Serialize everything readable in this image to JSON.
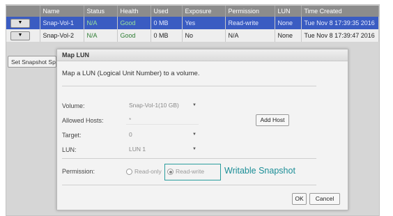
{
  "table": {
    "headers": [
      "",
      "Name",
      "Status",
      "Health",
      "Used",
      "Exposure",
      "Permission",
      "LUN",
      "Time Created"
    ],
    "rows": [
      {
        "arrow": "▼",
        "name": "Snap-Vol-1",
        "status": "N/A",
        "health": "Good",
        "used": "0 MB",
        "exposure": "Yes",
        "permission": "Read-write",
        "lun": "None",
        "time": "Tue Nov 8 17:39:35 2016"
      },
      {
        "arrow": "▼",
        "name": "Snap-Vol-2",
        "status": "N/A",
        "health": "Good",
        "used": "0 MB",
        "exposure": "No",
        "permission": "N/A",
        "lun": "None",
        "time": "Tue Nov 8 17:39:47 2016"
      }
    ]
  },
  "toolbar": {
    "set_snapshot_label": "Set Snapshot Sp"
  },
  "dialog": {
    "title": "Map LUN",
    "description": "Map a LUN (Logical Unit Number) to a volume.",
    "volume_label": "Volume:",
    "volume_value": "Snap-Vol-1(10 GB)",
    "allowed_hosts_label": "Allowed Hosts:",
    "allowed_hosts_value": "*",
    "add_host_label": "Add Host",
    "target_label": "Target:",
    "target_value": "0",
    "lun_label": "LUN:",
    "lun_value": "LUN 1",
    "permission_label": "Permission:",
    "perm_readonly": "Read-only",
    "perm_readwrite": "Read-write",
    "ok_label": "OK",
    "cancel_label": "Cancel"
  },
  "annotation": {
    "text": "Writable Snapshot",
    "color": "#1a8d96"
  },
  "colors": {
    "selected_row": "#3a5cc2",
    "header": "#8c8c8c",
    "good": "#2e7d32"
  }
}
